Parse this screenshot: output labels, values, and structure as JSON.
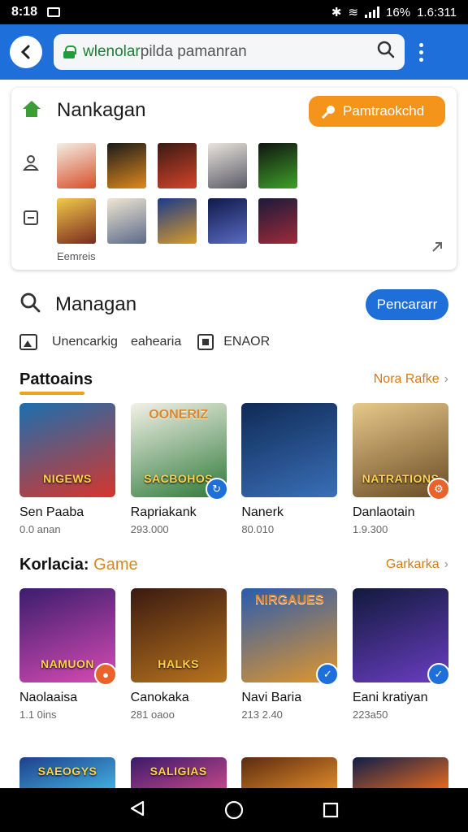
{
  "status": {
    "time": "8:18",
    "battery": "16%",
    "right_time": "1.6:311"
  },
  "browser": {
    "url_domain": "wlenolar",
    "url_rest": "pilda pamanran"
  },
  "top_card": {
    "title": "Nankagan",
    "action_label": "Pamtraokchd",
    "footer": "Eemreis"
  },
  "search": {
    "title": "Managan",
    "button_label": "Pencararr"
  },
  "filters": {
    "first": "Unencarkig",
    "second": "eahearia",
    "third": "ENAOR"
  },
  "section1": {
    "title": "Pattoains",
    "more": "Nora Rafke",
    "items": [
      {
        "name": "Sen Paaba",
        "sub": "0.0 anan",
        "banner": "NIGEWS",
        "badge": "",
        "colors": [
          "#1a6fb0",
          "#d7352c"
        ]
      },
      {
        "name": "Rapriakank",
        "sub": "293.000",
        "banner": "SACBOHOS",
        "top": "OONERIZ",
        "badge": "↻",
        "badge_color": "#1e6fd9",
        "colors": [
          "#f3f1e8",
          "#2f7a3a"
        ]
      },
      {
        "name": "Nanerk",
        "sub": "80.010",
        "banner": "",
        "badge": "",
        "colors": [
          "#0f2a55",
          "#3a6fb8"
        ]
      },
      {
        "name": "Danlaotain",
        "sub": "1.9.300",
        "banner": "NATRATIONS",
        "badge": "⚙",
        "badge_color": "#e8632a",
        "colors": [
          "#e7c98a",
          "#6a4a24"
        ]
      }
    ]
  },
  "section2": {
    "title_main": "Korlacia:",
    "title_accent": "Game",
    "more": "Garkarka",
    "items": [
      {
        "name": "Naolaaisa",
        "sub": "1.1 0ins",
        "banner": "NAMUON",
        "badge": "●",
        "badge_color": "#e8632a",
        "colors": [
          "#3a1d6e",
          "#d74bb2"
        ]
      },
      {
        "name": "Canokaka",
        "sub": "281 oaoo",
        "banner": "HALKS",
        "badge": "",
        "colors": [
          "#3a1a10",
          "#b8741e"
        ]
      },
      {
        "name": "Navi Baria",
        "sub": "213 2.40",
        "banner": "",
        "top": "NIRGAUES",
        "badge": "✓",
        "badge_color": "#1e6fd9",
        "colors": [
          "#2a5cae",
          "#e0962c"
        ]
      },
      {
        "name": "Eani kratiyan",
        "sub": "223a50",
        "banner": "",
        "badge": "✓",
        "badge_color": "#1e6fd9",
        "colors": [
          "#111a3c",
          "#6a3dc2"
        ]
      }
    ]
  },
  "section3": {
    "items": [
      {
        "banner": "SAEOGYS",
        "colors": [
          "#1e3f8a",
          "#41b0e0"
        ]
      },
      {
        "banner": "SALIGIAS",
        "colors": [
          "#3a1a6a",
          "#c4478a"
        ]
      },
      {
        "banner": "",
        "colors": [
          "#5a2a10",
          "#e08a2a"
        ]
      },
      {
        "banner": "",
        "colors": [
          "#0e1e4a",
          "#e86a1e"
        ]
      }
    ]
  },
  "thumbs_row1": [
    {
      "colors": [
        "#f2efe6",
        "#d84e2a"
      ]
    },
    {
      "colors": [
        "#1a1a1a",
        "#e08a1e"
      ]
    },
    {
      "colors": [
        "#3a1a14",
        "#d4442a"
      ]
    },
    {
      "colors": [
        "#e8e4dc",
        "#5a5a66"
      ]
    },
    {
      "colors": [
        "#101410",
        "#3fa02a"
      ]
    }
  ],
  "thumbs_row2": [
    {
      "colors": [
        "#f0c94a",
        "#7a2a1e"
      ]
    },
    {
      "colors": [
        "#f0e6d2",
        "#5a6a8a"
      ]
    },
    {
      "colors": [
        "#1a3a8a",
        "#d89a2a"
      ]
    },
    {
      "colors": [
        "#0e1a4a",
        "#5a6ac2"
      ]
    },
    {
      "colors": [
        "#1a1a3a",
        "#a02a3a"
      ]
    }
  ]
}
